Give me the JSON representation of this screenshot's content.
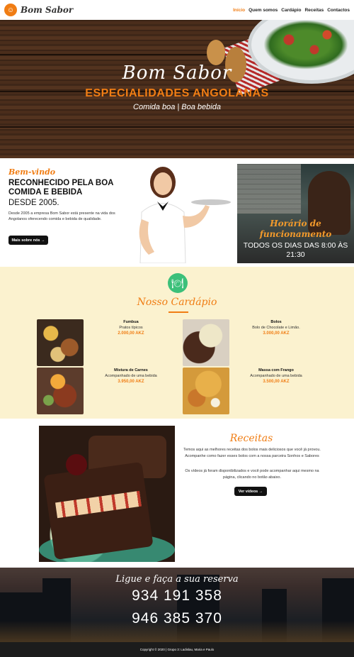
{
  "header": {
    "brand": "Bom Sabor",
    "logo_icon": "chef-hat-icon",
    "nav": [
      "Início",
      "Quem somos",
      "Cardápio",
      "Receitas",
      "Contactos"
    ],
    "active_nav": "Início",
    "accent_color": "#f07d14"
  },
  "hero": {
    "title": "Bom Sabor",
    "subtitle": "ESPECIALIDADES ANGOLANAS",
    "tagline": "Comida boa | Boa bebida"
  },
  "welcome": {
    "script_title": "Bem-vindo",
    "headline": "RECONHECIDO PELA BOA COMIDA E BEBIDA",
    "since": "DESDE 2005.",
    "text": "Desde 2005 a empresa Bom Sabor está presente na vida dos Angolanos oferecendo comida e bebida de qualidade.",
    "button": "Mais sobre nós →"
  },
  "hours": {
    "title": "Horário de funcionamento",
    "days": "TODOS OS DIAS DAS 8:00 ÀS 21:30"
  },
  "menu": {
    "icon": "plate-cutlery-icon",
    "title": "Nosso Cardápio",
    "items": [
      {
        "name": "Fumbua",
        "desc": "Pratos típicos",
        "price": "2.000,00 AKZ"
      },
      {
        "name": "Bolos",
        "desc": "Bolo de Chocolate e Limão.",
        "price": "3.000,00 AKZ"
      },
      {
        "name": "Mistura de Carnes",
        "desc": "Acompanhado de uma bebida",
        "price": "3.950,00 AKZ"
      },
      {
        "name": "Massa com Frango",
        "desc": "Acompanhado de uma bebida",
        "price": "3.500,00 AKZ"
      }
    ]
  },
  "recipes": {
    "title": "Receitas",
    "p1": "Temos aqui as melhores receitas dos bolos mais deliciosos que você já provou. Acompanhe como fazer esses bolos com a nossa parceira Sonhos e Sabores",
    "p2": "Os vídeos já foram disponibilizados e você pode acompanhar aqui mesmo na página, clicando no botão abaixo.",
    "button": "Ver vídeos →"
  },
  "reserve": {
    "title": "Ligue e faça a sua reserva",
    "phone1": "934 191 358",
    "phone2": "946 385 370"
  },
  "footer": {
    "text": "Copyright © 2020 | Grupo 3: Ladislau, Maria e Paulo"
  }
}
